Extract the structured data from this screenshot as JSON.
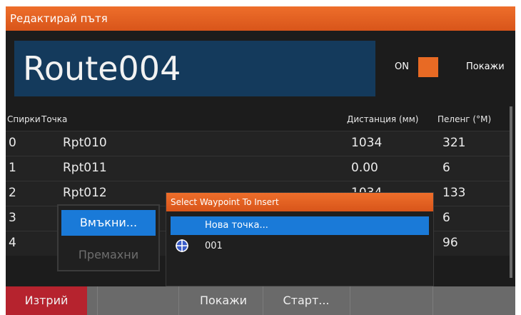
{
  "window": {
    "title": "Редактирай пътя"
  },
  "route": {
    "name": "Route004",
    "toggle_label": "ON",
    "show_label": "Покажи"
  },
  "table": {
    "headers": {
      "stops": "Спирки",
      "point": "Точка",
      "distance": "Дистанция (мм)",
      "bearing": "Пеленг (°M)"
    },
    "rows": [
      {
        "stop": "0",
        "point": "Rpt010",
        "distance": "1034",
        "bearing": "321"
      },
      {
        "stop": "1",
        "point": "Rpt011",
        "distance": "0.00",
        "bearing": "6"
      },
      {
        "stop": "2",
        "point": "Rpt012",
        "distance": "1034",
        "bearing": "133"
      },
      {
        "stop": "3",
        "point": "",
        "distance": "",
        "bearing": "6"
      },
      {
        "stop": "4",
        "point": "",
        "distance": "",
        "bearing": "96"
      }
    ]
  },
  "context_menu": {
    "insert": "Вмъкни...",
    "remove": "Премахни"
  },
  "popup": {
    "title": "Select Waypoint To Insert",
    "new_point": "Нова точка...",
    "waypoints": [
      {
        "name": "001",
        "icon": "waypoint-crosshair-icon"
      }
    ]
  },
  "bottom_bar": {
    "delete": "Изтрий",
    "show": "Покажи",
    "start": "Старт..."
  },
  "colors": {
    "accent_orange": "#e86a24",
    "selection_blue": "#1a7ad8",
    "delete_red": "#b6232e",
    "route_bg": "#143a5c"
  }
}
